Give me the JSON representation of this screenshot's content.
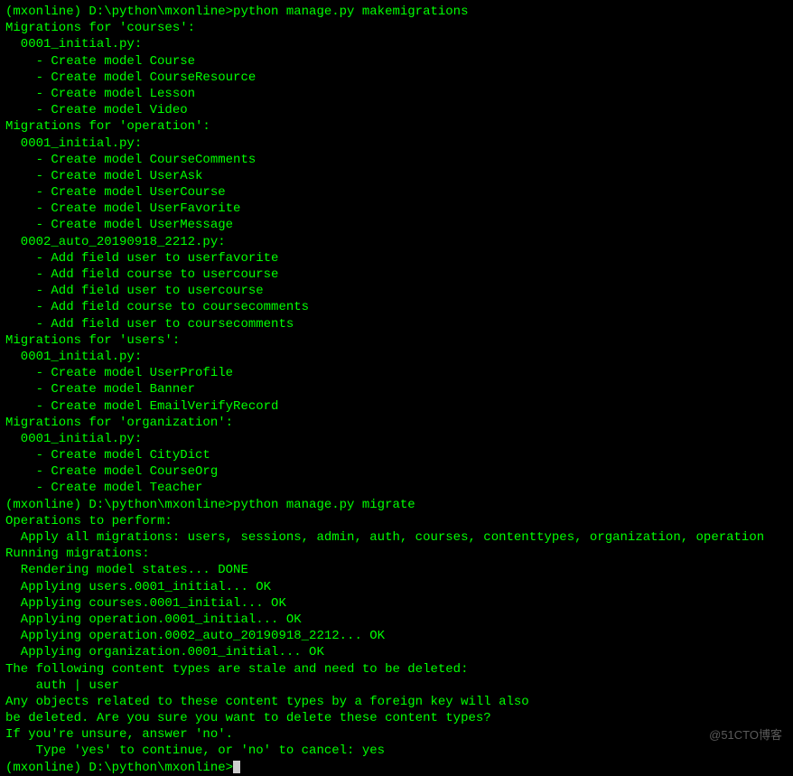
{
  "lines": [
    {
      "text": "(mxonline) D:\\python\\mxonline>python manage.py makemigrations",
      "name": "prompt-makemigrations"
    },
    {
      "text": "Migrations for 'courses':",
      "name": "migrations-courses-header"
    },
    {
      "text": "  0001_initial.py:",
      "name": "courses-0001"
    },
    {
      "text": "    - Create model Course",
      "name": "courses-create-course"
    },
    {
      "text": "    - Create model CourseResource",
      "name": "courses-create-courseresource"
    },
    {
      "text": "    - Create model Lesson",
      "name": "courses-create-lesson"
    },
    {
      "text": "    - Create model Video",
      "name": "courses-create-video"
    },
    {
      "text": "Migrations for 'operation':",
      "name": "migrations-operation-header"
    },
    {
      "text": "  0001_initial.py:",
      "name": "operation-0001"
    },
    {
      "text": "    - Create model CourseComments",
      "name": "operation-create-coursecomments"
    },
    {
      "text": "    - Create model UserAsk",
      "name": "operation-create-userask"
    },
    {
      "text": "    - Create model UserCourse",
      "name": "operation-create-usercourse"
    },
    {
      "text": "    - Create model UserFavorite",
      "name": "operation-create-userfavorite"
    },
    {
      "text": "    - Create model UserMessage",
      "name": "operation-create-usermessage"
    },
    {
      "text": "  0002_auto_20190918_2212.py:",
      "name": "operation-0002"
    },
    {
      "text": "    - Add field user to userfavorite",
      "name": "operation-add-user-userfavorite"
    },
    {
      "text": "    - Add field course to usercourse",
      "name": "operation-add-course-usercourse"
    },
    {
      "text": "    - Add field user to usercourse",
      "name": "operation-add-user-usercourse"
    },
    {
      "text": "    - Add field course to coursecomments",
      "name": "operation-add-course-coursecomments"
    },
    {
      "text": "    - Add field user to coursecomments",
      "name": "operation-add-user-coursecomments"
    },
    {
      "text": "Migrations for 'users':",
      "name": "migrations-users-header"
    },
    {
      "text": "  0001_initial.py:",
      "name": "users-0001"
    },
    {
      "text": "    - Create model UserProfile",
      "name": "users-create-userprofile"
    },
    {
      "text": "    - Create model Banner",
      "name": "users-create-banner"
    },
    {
      "text": "    - Create model EmailVerifyRecord",
      "name": "users-create-emailverifyrecord"
    },
    {
      "text": "Migrations for 'organization':",
      "name": "migrations-organization-header"
    },
    {
      "text": "  0001_initial.py:",
      "name": "organization-0001"
    },
    {
      "text": "    - Create model CityDict",
      "name": "organization-create-citydict"
    },
    {
      "text": "    - Create model CourseOrg",
      "name": "organization-create-courseorg"
    },
    {
      "text": "    - Create model Teacher",
      "name": "organization-create-teacher"
    },
    {
      "text": "",
      "name": "blank-1"
    },
    {
      "text": "(mxonline) D:\\python\\mxonline>python manage.py migrate",
      "name": "prompt-migrate"
    },
    {
      "text": "Operations to perform:",
      "name": "operations-to-perform"
    },
    {
      "text": "  Apply all migrations: users, sessions, admin, auth, courses, contenttypes, organization, operation",
      "name": "apply-all-migrations"
    },
    {
      "text": "Running migrations:",
      "name": "running-migrations"
    },
    {
      "text": "  Rendering model states... DONE",
      "name": "rendering-model-states"
    },
    {
      "text": "  Applying users.0001_initial... OK",
      "name": "applying-users-0001"
    },
    {
      "text": "  Applying courses.0001_initial... OK",
      "name": "applying-courses-0001"
    },
    {
      "text": "  Applying operation.0001_initial... OK",
      "name": "applying-operation-0001"
    },
    {
      "text": "  Applying operation.0002_auto_20190918_2212... OK",
      "name": "applying-operation-0002"
    },
    {
      "text": "  Applying organization.0001_initial... OK",
      "name": "applying-organization-0001"
    },
    {
      "text": "The following content types are stale and need to be deleted:",
      "name": "stale-content-types"
    },
    {
      "text": "",
      "name": "blank-2"
    },
    {
      "text": "    auth | user",
      "name": "auth-user"
    },
    {
      "text": "",
      "name": "blank-3"
    },
    {
      "text": "Any objects related to these content types by a foreign key will also",
      "name": "any-objects-1"
    },
    {
      "text": "be deleted. Are you sure you want to delete these content types?",
      "name": "any-objects-2"
    },
    {
      "text": "If you're unsure, answer 'no'.",
      "name": "if-unsure"
    },
    {
      "text": "",
      "name": "blank-4"
    },
    {
      "text": "    Type 'yes' to continue, or 'no' to cancel: yes",
      "name": "type-yes-no"
    },
    {
      "text": "",
      "name": "blank-5"
    }
  ],
  "final_prompt": "(mxonline) D:\\python\\mxonline>",
  "watermark": "@51CTO博客"
}
